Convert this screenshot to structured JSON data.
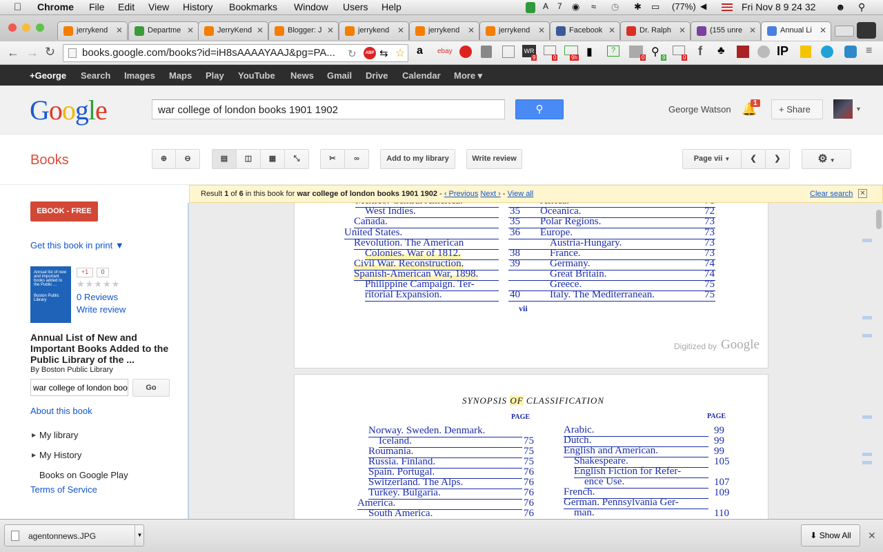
{
  "menubar": {
    "app": "Chrome",
    "items": [
      "File",
      "Edit",
      "View",
      "History",
      "Bookmarks",
      "Window",
      "Users",
      "Help"
    ],
    "status": {
      "adobe_count": "7",
      "battery": "(77%)",
      "datetime": "Fri Nov 8  9 24 32"
    }
  },
  "tabs": [
    {
      "label": "jerrykend",
      "color": "#f57d00"
    },
    {
      "label": "Departme",
      "color": "#3a9b3a"
    },
    {
      "label": "JerryKend",
      "color": "#f57d00"
    },
    {
      "label": "Blogger: J",
      "color": "#f57d00"
    },
    {
      "label": "jerrykend",
      "color": "#f57d00"
    },
    {
      "label": "jerrykend",
      "color": "#f57d00"
    },
    {
      "label": "jerrykend",
      "color": "#f57d00"
    },
    {
      "label": "Facebook",
      "color": "#3b5998"
    },
    {
      "label": "Dr. Ralph",
      "color": "#d93025"
    },
    {
      "label": "(155 unre",
      "color": "#7b3fa0"
    },
    {
      "label": "Annual Li",
      "color": "#4a7fe0"
    }
  ],
  "omnibox": {
    "url": "books.google.com/books?id=iH8sAAAAYAAJ&pg=PA..."
  },
  "extensions": {
    "badge1": "9",
    "badge2": "0",
    "badge3": "9h",
    "badge4": "0",
    "badge5": "0",
    "badge6": "9",
    "ip": "IP"
  },
  "gbar": [
    "+George",
    "Search",
    "Images",
    "Maps",
    "Play",
    "YouTube",
    "News",
    "Gmail",
    "Drive",
    "Calendar",
    "More ▾"
  ],
  "header": {
    "logo": "Google",
    "query": "war college of london books 1901 1902",
    "user": "George Watson",
    "notif": "1",
    "share": "Share"
  },
  "books": {
    "title": "Books",
    "add_library": "Add to my library",
    "write_review": "Write review",
    "page_select": "Page vii"
  },
  "result": {
    "prefix": "Result ",
    "n": "1",
    "of": " of ",
    "total": "6",
    "mid": " in this book for ",
    "query": "war college of london books 1901 1902",
    "prev": "‹ Previous",
    "next": "Next ›",
    "viewall": "View all",
    "clear": "Clear search"
  },
  "sidebar": {
    "ebook": "EBOOK - FREE",
    "getprint": "Get this book in print",
    "cover_text": "Annual list of new and important books added to the Public ...",
    "cover_pub": "Boston Public Library",
    "gplus": "+1",
    "gcount": "0",
    "reviews": "0 Reviews",
    "write_review": "Write review",
    "book_title": "Annual List of New and Important Books Added to the Public Library of the ...",
    "by": "By Boston Public Library",
    "search_value": "war college of london boo",
    "go": "Go",
    "about": "About this book",
    "my_library": "My library",
    "my_history": "My History",
    "play": "Books on Google Play",
    "tos": "Terms of Service"
  },
  "page1": {
    "left": [
      {
        "t": "Mexico.   Central   America."
      },
      {
        "t": "West  Indies."
      },
      {
        "t": "Canada."
      },
      {
        "t": "United  States."
      },
      {
        "t": "Revolution.   The  American"
      },
      {
        "t": "Colonies.   War of  1812."
      },
      {
        "t": "Civil  War.   Reconstruction."
      },
      {
        "t": "Spanish-American  War,  1898."
      },
      {
        "t": "Philippine  Campaign.   Ter-"
      },
      {
        "t": "ritorial  Expansion."
      }
    ],
    "midnums": [
      "35",
      "35",
      "36",
      "38",
      "39",
      "40"
    ],
    "right": [
      {
        "t": "Africa."
      },
      {
        "t": "Oceanica."
      },
      {
        "t": "Polar  Regions."
      },
      {
        "t": "Europe."
      },
      {
        "t": "Austria-Hungary."
      },
      {
        "t": "France."
      },
      {
        "t": "Germany."
      },
      {
        "t": "Great  Britain."
      },
      {
        "t": "Greece."
      },
      {
        "t": "Italy.   The  Mediterranean."
      }
    ],
    "rnums": [
      "71",
      "72",
      "73",
      "73",
      "73",
      "73",
      "74",
      "74",
      "75",
      "75"
    ],
    "pagenum": "vii",
    "digitized": "Digitized by",
    "dgoogle": "Google"
  },
  "page2": {
    "heading_a": "SYNOPSIS ",
    "heading_b": "OF",
    "heading_c": " CLASSIFICATION",
    "page_lbl": "PAGE",
    "left": [
      {
        "t": "Norway.   Sweden.   Denmark."
      },
      {
        "t": "Iceland."
      },
      {
        "t": "Roumania."
      },
      {
        "t": "Russia.   Finland."
      },
      {
        "t": "Spain.   Portugal."
      },
      {
        "t": "Switzerland.   The  Alps."
      },
      {
        "t": "Turkey.   Bulgaria."
      },
      {
        "t": "America."
      },
      {
        "t": "South  America."
      }
    ],
    "lnums": [
      "75",
      "75",
      "75",
      "76",
      "76",
      "76",
      "76",
      "76"
    ],
    "right": [
      {
        "t": "Arabic."
      },
      {
        "t": "Dutch."
      },
      {
        "t": "English  and  American."
      },
      {
        "t": "Shakespeare."
      },
      {
        "t": "English   Fiction   for   Refer-"
      },
      {
        "t": "ence  Use."
      },
      {
        "t": "French."
      },
      {
        "t": "German.    Pennsylvania   Ger-"
      },
      {
        "t": "man."
      }
    ],
    "rnums": [
      "99",
      "99",
      "99",
      "105",
      "107",
      "109",
      "110"
    ]
  },
  "download": {
    "file": "agentonnews.JPG",
    "showall": "Show All"
  }
}
